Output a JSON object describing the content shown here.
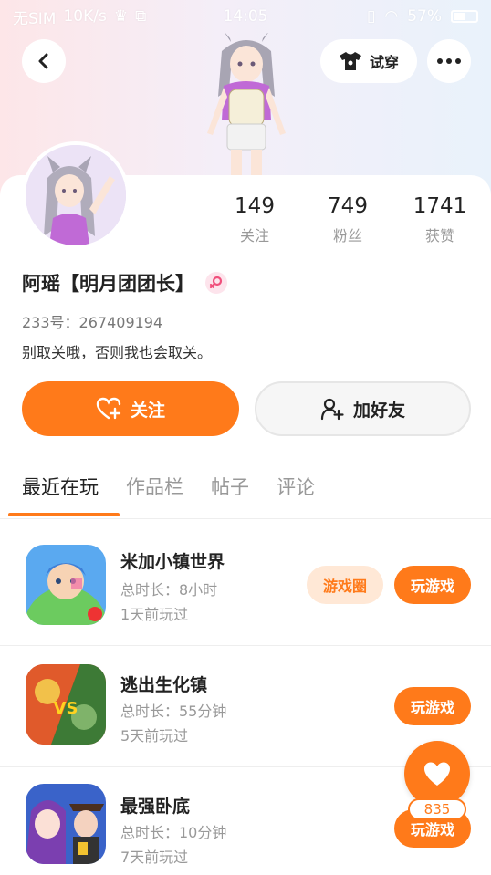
{
  "status_bar": {
    "carrier": "无SIM",
    "speed": "10K/s",
    "time": "14:05",
    "battery": "57%"
  },
  "header": {
    "try_on_label": "试穿"
  },
  "profile": {
    "stats": [
      {
        "value": "149",
        "label": "关注"
      },
      {
        "value": "749",
        "label": "粉丝"
      },
      {
        "value": "1741",
        "label": "获赞"
      }
    ],
    "name": "阿瑶【明月团团长】",
    "gender": "female",
    "uid": "233号：267409194",
    "bio": "别取关哦，否则我也会取关。"
  },
  "actions": {
    "follow_label": "关注",
    "add_friend_label": "加好友"
  },
  "tabs": [
    {
      "label": "最近在玩",
      "active": true
    },
    {
      "label": "作品栏",
      "active": false
    },
    {
      "label": "帖子",
      "active": false
    },
    {
      "label": "评论",
      "active": false
    }
  ],
  "games": [
    {
      "title": "米加小镇世界",
      "duration": "总时长：8小时",
      "last_played": "1天前玩过",
      "circle_label": "游戏圈",
      "play_label": "玩游戏"
    },
    {
      "title": "逃出生化镇",
      "duration": "总时长：55分钟",
      "last_played": "5天前玩过",
      "play_label": "玩游戏"
    },
    {
      "title": "最强卧底",
      "duration": "总时长：10分钟",
      "last_played": "7天前玩过",
      "play_label": "玩游戏"
    }
  ],
  "like": {
    "count": "835"
  },
  "colors": {
    "accent": "#ff7a1a",
    "accent_light": "#ffe8d6",
    "muted_text": "#999999"
  }
}
